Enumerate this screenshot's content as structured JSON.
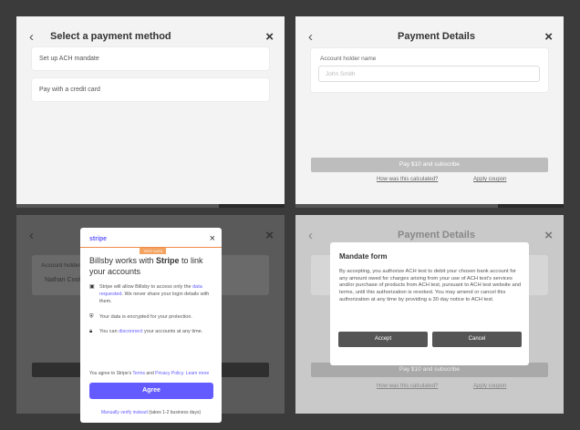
{
  "panel1": {
    "title": "Select a payment method",
    "options": [
      "Set up ACH mandate",
      "Pay with a credit card"
    ]
  },
  "panel2": {
    "title": "Payment Details",
    "account_label": "Account holder name",
    "account_placeholder": "John Smith",
    "pay_button": "Pay $10 and subscribe",
    "calc_link": "How was this calculated?",
    "coupon_link": "Apply coupon"
  },
  "panel3": {
    "bg_label": "Account holder",
    "bg_value": "Nathan Cook",
    "stripe": {
      "logo": "stripe",
      "badge": "TEST DATA",
      "heading_pre": "Billsby works with ",
      "heading_brand": "Stripe",
      "heading_post": " to link your accounts",
      "item1_pre": "Stripe will allow Billsby to access only the ",
      "item1_link": "data requested",
      "item1_mid": ". We never share your login details with them.",
      "item2": "Your data is encrypted for your protection.",
      "item3_pre": "You can ",
      "item3_link": "disconnect",
      "item3_post": " your accounts at any time.",
      "agree_pre": "You agree to Stripe's ",
      "agree_terms": "Terms",
      "agree_and": " and ",
      "agree_privacy": "Privacy Policy",
      "agree_learn": ". Learn more",
      "agree_button": "Agree",
      "manual_link": "Manually verify instead",
      "manual_note": " (takes 1-2 business days)"
    }
  },
  "panel4": {
    "title": "Payment Details",
    "pay_button": "Pay $10 and subscribe",
    "calc_link": "How was this calculated?",
    "coupon_link": "Apply coupon",
    "mandate": {
      "title": "Mandate form",
      "body": "By accepting, you authorize ACH test to debit your chosen bank account for any amount owed for charges arising from your use of ACH test's services and/or purchase of products from ACH test, pursuant to ACH test website and terms, until this authorization is revoked. You may amend or cancel this authorization at any time by providing a 30 day notice to ACH test.",
      "accept": "Accept",
      "cancel": "Cancel"
    }
  },
  "icons": {
    "back": "‹",
    "close": "×"
  }
}
